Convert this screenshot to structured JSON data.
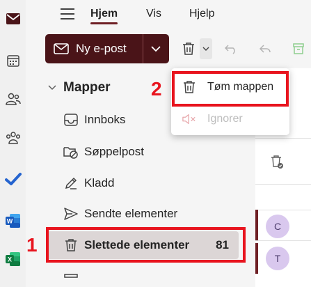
{
  "nav": {
    "tabs": [
      "Hjem",
      "Vis",
      "Hjelp"
    ]
  },
  "toolbar": {
    "new_mail_label": "Ny e-post"
  },
  "folders": {
    "section_label": "Mapper",
    "items": [
      {
        "label": "Innboks",
        "icon": "inbox-icon",
        "count": ""
      },
      {
        "label": "Søppelpost",
        "icon": "junk-icon",
        "count": ""
      },
      {
        "label": "Kladd",
        "icon": "draft-icon",
        "count": ""
      },
      {
        "label": "Sendte elementer",
        "icon": "sent-icon",
        "count": ""
      },
      {
        "label": "Slettede elementer",
        "icon": "trash-icon",
        "count": "81"
      }
    ]
  },
  "delete_menu": {
    "items": [
      {
        "label": "Tøm mappen",
        "icon": "trash-icon",
        "enabled": true
      },
      {
        "label": "Ignorer",
        "icon": "mute-icon",
        "enabled": false
      }
    ]
  },
  "message_list": {
    "avatars": [
      "C",
      "T"
    ]
  },
  "callouts": {
    "one": "1",
    "two": "2"
  },
  "colors": {
    "brand": "#4a1418",
    "accent": "#6e1f24",
    "highlight": "#e8141e"
  }
}
